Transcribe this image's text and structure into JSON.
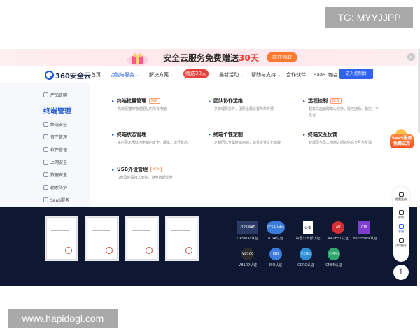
{
  "watermarks": {
    "top": "TG: MYYJJPP",
    "bottom": "www.hapidogi.com"
  },
  "banner": {
    "text_prefix": "安全云服务免费赠送",
    "text_highlight": "30天",
    "button": "前往领取",
    "close": "×"
  },
  "nav": {
    "logo": "360安全云",
    "items": [
      {
        "label": "首页"
      },
      {
        "label": "功能与服务"
      },
      {
        "label": "解决方案"
      },
      {
        "label": "最新活动"
      },
      {
        "label": "帮助与支持"
      },
      {
        "label": "合作伙伴"
      },
      {
        "label": "SaaS 商店"
      }
    ],
    "badge": "赠送30天",
    "console": "进入控制台",
    "caret": "⌄"
  },
  "sidebar": {
    "items": [
      {
        "label": "产品说明"
      },
      {
        "label": "终端管理"
      },
      {
        "label": "终端安全"
      },
      {
        "label": "资产管理"
      },
      {
        "label": "软件管理"
      },
      {
        "label": "上网安全"
      },
      {
        "label": "数据安全"
      },
      {
        "label": "勒索防护"
      },
      {
        "label": "SaaS服务"
      }
    ]
  },
  "features": [
    {
      "title": "终端批量管理",
      "tag": "NEW",
      "desc": "高效便捷的管理团队内所有电脑"
    },
    {
      "title": "团队协作运维",
      "tag": "",
      "desc": "多管理员协作，团队全局设置简单方便"
    },
    {
      "title": "远程控制",
      "tag": "NEW",
      "desc": "超高清画面跨端心交换，操控流畅、稳定、不延迟"
    },
    {
      "title": "终端状态管理",
      "tag": "",
      "desc": "实时展示团队内电脑的安全、版本、运行状态"
    },
    {
      "title": "终端个性定制",
      "tag": "",
      "desc": "定制团队专属终端画面，彰显企业文化面貌"
    },
    {
      "title": "终端交互反馈",
      "tag": "",
      "desc": "管理员与员工电脑之间的信息交互与反馈"
    },
    {
      "title": "USB外设管理",
      "tag": "NEW",
      "desc": "U盘及外设接入管控，避免数据外泄"
    }
  ],
  "certifications": [
    {
      "label": "OPSWAT认证",
      "logo": "OPSWAT",
      "color": "#2a3b66"
    },
    {
      "label": "ICSA认证",
      "logo": "ICSA labs",
      "color": "#3d7bd9"
    },
    {
      "label": "中国公安部认证",
      "logo": "公安",
      "color": "#ffffff"
    },
    {
      "label": "AV-TEST认证",
      "logo": "AV",
      "color": "#d32f2f"
    },
    {
      "label": "Checkmark认证",
      "logo": "CM",
      "color": "#7e3fd1"
    },
    {
      "label": "VB100认证",
      "logo": "VB100",
      "color": "#2b2b2b"
    },
    {
      "label": "ISO认证",
      "logo": "ISO",
      "color": "#3c7be0"
    },
    {
      "label": "CCRC认证",
      "logo": "CCRC",
      "color": "#2f8fd6"
    },
    {
      "label": "CMMI认证",
      "logo": "CMMI",
      "color": "#2fa66b"
    }
  ],
  "floating": {
    "saas_promo": "SaaS服务免费试用",
    "tools": [
      {
        "label": "免费注册"
      },
      {
        "label": "帮助"
      },
      {
        "label": "客服"
      },
      {
        "label": "试用指导"
      }
    ],
    "back_to_top": "↑"
  }
}
